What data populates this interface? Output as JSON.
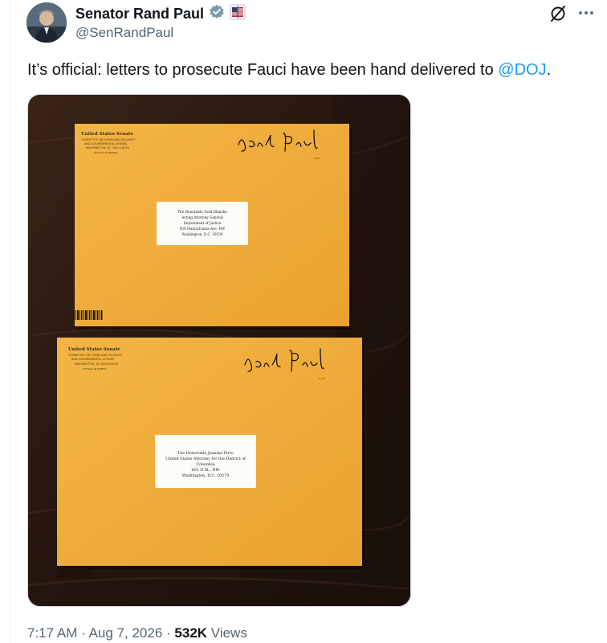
{
  "author": {
    "display_name": "Senator Rand Paul",
    "handle": "@SenRandPaul"
  },
  "tweet": {
    "text_before_mention": "It’s official: letters to prosecute Fauci have been hand delivered to ",
    "mention": "@DOJ",
    "text_after_mention": "."
  },
  "envelopes": [
    {
      "sender_lines": [
        "United States Senate",
        "COMMITTEE ON HOMELAND SECURITY",
        "AND GOVERNMENTAL AFFAIRS",
        "WASHINGTON, DC 20510-6250",
        "OFFICIAL BUSINESS"
      ],
      "signature": "Rand Paul",
      "address_lines": [
        "The Honorable Todd Blanche",
        "Acting Attorney General",
        "Department of Justice",
        "950 Pennsylvania Ave, NW",
        "Washington, D.C. 20530"
      ]
    },
    {
      "sender_lines": [
        "United States Senate",
        "COMMITTEE ON HOMELAND SECURITY",
        "AND GOVERNMENTAL AFFAIRS",
        "WASHINGTON, DC 20510-6250",
        "OFFICIAL BUSINESS"
      ],
      "signature": "Rand Paul",
      "address_lines": [
        "The Honorable Jeanine Pirro",
        "United States Attorney for the District of",
        "Columbia",
        "601 D St., NW",
        "Washington, D.C. 20579"
      ]
    }
  ],
  "meta": {
    "time": "7:17 AM",
    "separator": "·",
    "date": "Aug 7, 2026",
    "views_count": "532K",
    "views_label": "Views"
  },
  "colors": {
    "link": "#1d9bf0",
    "verified": "#829aab",
    "envelope": "#f0ac3a",
    "table": "#2a1a12"
  },
  "icons": [
    "verified-badge-icon",
    "us-senate-flag-icon",
    "grok-icon",
    "more-icon"
  ]
}
